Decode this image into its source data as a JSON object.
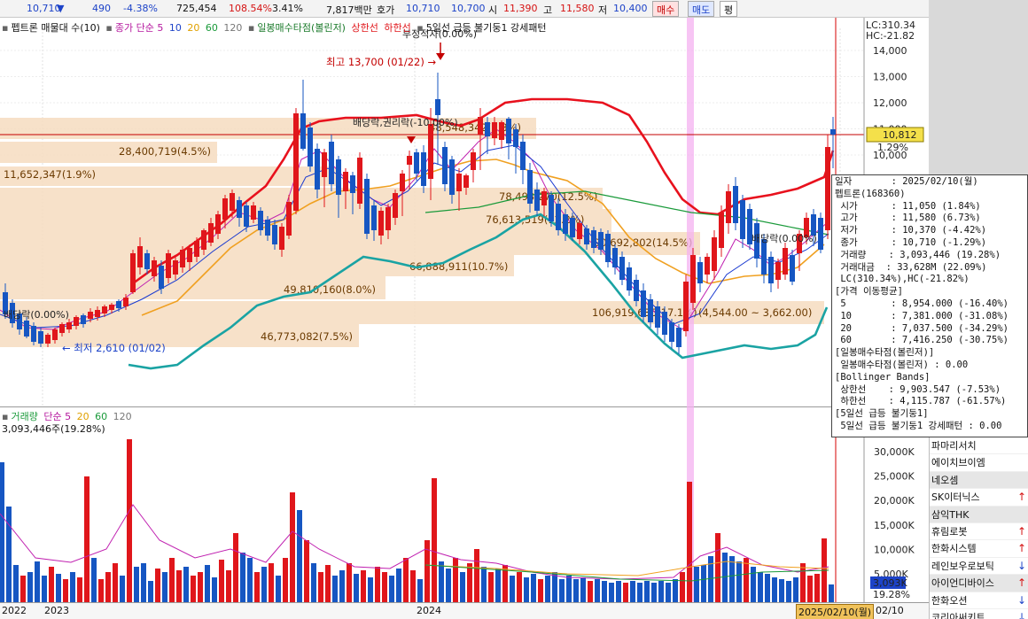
{
  "quote_bar": {
    "price": "10,710",
    "change": "490",
    "change_pct": "-4.38%",
    "volume": "725,454",
    "volume_ratio": "108.54%",
    "turnover": "3.41%",
    "amount": "7,817백만",
    "bid_label": "호가",
    "bid": "10,710",
    "ask": "10,700",
    "open_label": "시",
    "open": "11,390",
    "high_label": "고",
    "high": "11,580",
    "low_label": "저",
    "low": "10,400",
    "buy_button": "매수",
    "sell_button": "매도",
    "eval_button": "평"
  },
  "price_legend": {
    "stock": "펩트론 매물대 수(10)",
    "ma_label": "종가 단순 5",
    "ma10": "10",
    "ma20": "20",
    "ma60": "60",
    "ma120": "120",
    "bollinger": "일봉매수타점(볼린저)",
    "upper": "상한선",
    "lower": "하한선",
    "pattern": "5일선 급등 불기둥1 강세패턴"
  },
  "lc_hc": {
    "lc": "LC:310.34",
    "hc": "HC:-21.82"
  },
  "price_axis": {
    "ticks": [
      "14,000",
      "13,000",
      "12,000",
      "11,000",
      "10,000"
    ],
    "current_price": "10,812",
    "current_pct": "1.29%"
  },
  "annotations": {
    "high": "최고 13,700 (01/22)",
    "low": "최저 2,610 (01/02)",
    "upper_limit": "부정적자(0.00%)",
    "dividend1": "배당락,권리락(-10.00%)",
    "dividend2": "배당락(0.00%)",
    "dividend3": "배당락(0.00%)",
    "range_price": "(4,544.00 ~ 3,662.00)"
  },
  "volume_profile": [
    "11,652,347(1.9%)",
    "28,400,719(4.5%)",
    "48,548,342(7.8%)",
    "78,493,270(12.5%)",
    "76,613,519(12.2%)",
    "90,692,802(14.5%)",
    "66,888,911(10.7%)",
    "49,810,160(8.0%)",
    "106,919,636(17.1%)",
    "46,773,082(7.5%)"
  ],
  "volume_legend": {
    "label": "거래량",
    "ma_label": "단순 5",
    "ma20": "20",
    "ma60": "60",
    "ma120": "120",
    "current": "3,093,446주(19.28%)"
  },
  "volume_axis": {
    "ticks": [
      "30,000K",
      "25,000K",
      "20,000K",
      "15,000K",
      "10,000K",
      "5,000K"
    ],
    "current": "3,093K",
    "current_pct": "19.28%"
  },
  "date_axis": {
    "labels": [
      "2022",
      "2023",
      "2024"
    ],
    "cursor_date": "2025/02/10(월)",
    "right_label": "02/10"
  },
  "tooltip": {
    "lines": [
      "일자       : 2025/02/10(월)",
      "펩트론(168360)",
      " 시가      : 11,050 (1.84%)",
      " 고가      : 11,580 (6.73%)",
      " 저가      : 10,370 (-4.42%)",
      " 종가      : 10,710 (-1.29%)",
      " 거래량    : 3,093,446 (19.28%)",
      " 거래대금  : 33,628M (22.09%)",
      " LC(310.34%),HC(-21.82%)",
      "[가격 이동평균]",
      " 5        : 8,954.000 (-16.40%)",
      " 10       : 7,381.000 (-31.08%)",
      " 20       : 7,037.500 (-34.29%)",
      " 60       : 7,416.250 (-30.75%)",
      "[일봉매수타점(볼린저)]",
      " 일봉매수타점(볼린저) : 0.00",
      "[Bollinger Bands]",
      " 상한선    : 9,903.547 (-7.53%)",
      " 하한선    : 4,115.787 (-61.57%)",
      "[5일선 급등 불기둥1]",
      " 5일선 급등 불기둥1 강세패턴 : 0.00"
    ]
  },
  "stock_list": [
    {
      "name": "파마리서치",
      "arrow": "",
      "alt": false
    },
    {
      "name": "에이치브이엠",
      "arrow": "",
      "alt": false
    },
    {
      "name": "네오셈",
      "arrow": "",
      "alt": true
    },
    {
      "name": "SK이터닉스",
      "arrow": "↑",
      "alt": false
    },
    {
      "name": "삼익THK",
      "arrow": "",
      "alt": true
    },
    {
      "name": "휴림로봇",
      "arrow": "↑",
      "alt": false
    },
    {
      "name": "한화시스템",
      "arrow": "↑",
      "alt": false
    },
    {
      "name": "레인보우로보틱",
      "arrow": "↓",
      "alt": false
    },
    {
      "name": "아이언디바이스",
      "arrow": "↑",
      "alt": true
    },
    {
      "name": "한화오션",
      "arrow": "↓",
      "alt": false
    },
    {
      "name": "코리아써키트",
      "arrow": "↓",
      "alt": false
    }
  ],
  "colors": {
    "up": "#e0161b",
    "down": "#1656c2",
    "band_upper": "#e8111d",
    "band_lower": "#1aa3a3",
    "ma20": "#f0a020",
    "ma60": "#1a9a3a",
    "profile": "#f6dcc0",
    "highlight": "#f4b2f0"
  }
}
